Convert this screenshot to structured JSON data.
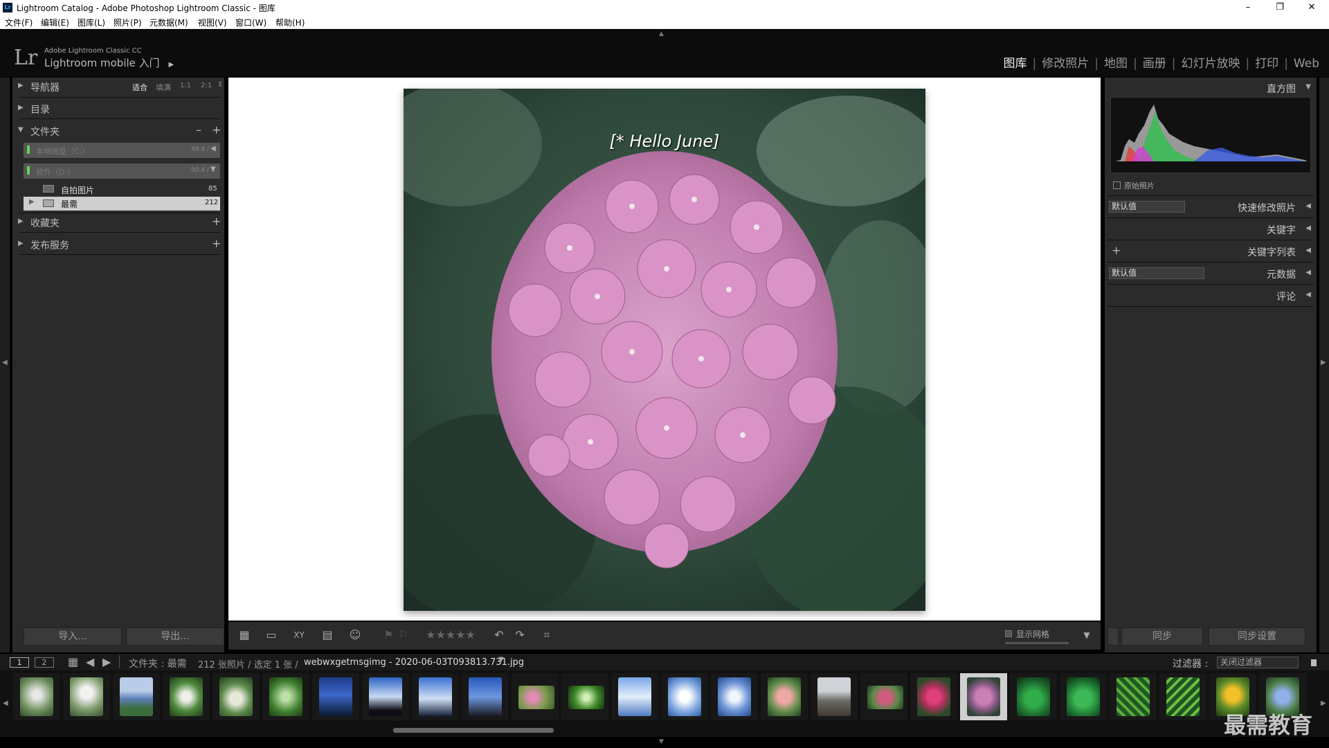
{
  "window": {
    "title": "Lightroom Catalog - Adobe Photoshop Lightroom Classic - 图库",
    "app_icon_text": "Lr",
    "controls": [
      "–",
      "❐",
      "✕"
    ]
  },
  "menu": [
    "文件(F)",
    "编辑(E)",
    "图库(L)",
    "照片(P)",
    "元数据(M)",
    "视图(V)",
    "窗口(W)",
    "帮助(H)"
  ],
  "identity": {
    "logo": "Lr",
    "small": "Adobe Lightroom Classic CC",
    "main": "Lightroom mobile 入门",
    "arrow": "▶"
  },
  "modules": [
    "图库",
    "修改照片",
    "地图",
    "画册",
    "幻灯片放映",
    "打印",
    "Web"
  ],
  "active_module": "图库",
  "left_panel": {
    "navigator": {
      "label": "导航器",
      "zoom_options": [
        "适合",
        "填满",
        "1:1",
        "2:1"
      ],
      "active_zoom": "适合"
    },
    "catalog": {
      "label": "目录"
    },
    "folders": {
      "label": "文件夹",
      "minus": "–",
      "plus": "+",
      "volumes": [
        {
          "name": "本地磁盘（C:）",
          "info": "49.9 / ..."
        },
        {
          "name": "软件（D:）",
          "info": "90.4 / ..."
        }
      ],
      "items": [
        {
          "name": "自拍图片",
          "count": "85"
        },
        {
          "name": "最需",
          "count": "212"
        }
      ]
    },
    "collections": {
      "label": "收藏夹",
      "plus": "+"
    },
    "publish": {
      "label": "发布服务",
      "plus": "+"
    },
    "import_btn": "导入...",
    "export_btn": "导出..."
  },
  "right_panel": {
    "histogram": {
      "label": "直方图",
      "original_photo": "原始照片"
    },
    "quick_develop": {
      "label": "快速修改照片",
      "preset": "默认值"
    },
    "keywording": {
      "label": "关键字"
    },
    "keyword_list": {
      "label": "关键字列表",
      "plus": "+"
    },
    "metadata": {
      "label": "元数据",
      "preset": "默认值"
    },
    "comments": {
      "label": "评论"
    },
    "sync_btn": "同步",
    "sync_settings_btn": "同步设置"
  },
  "photo": {
    "overlay_text": "[* Hello June]"
  },
  "toolbar": {
    "stars": "★★★★★",
    "show_grid": "显示网格",
    "xy_label": "XY"
  },
  "filmstrip_bar": {
    "screen1": "1",
    "screen2": "2",
    "source_label": "文件夹 : 最需",
    "count_text": "212 张照片 / 选定 1 张 /",
    "filename": "webwxgetmsgimg - 2020-06-03T093813.731.jpg",
    "filter_label": "过滤器 :",
    "filter_value": "关闭过滤器"
  },
  "watermark": "最需教育",
  "colors": {
    "active_module": "#f0f0f0",
    "panel_bg": "#2b2b2b",
    "accent_flower": "#c980b4"
  }
}
